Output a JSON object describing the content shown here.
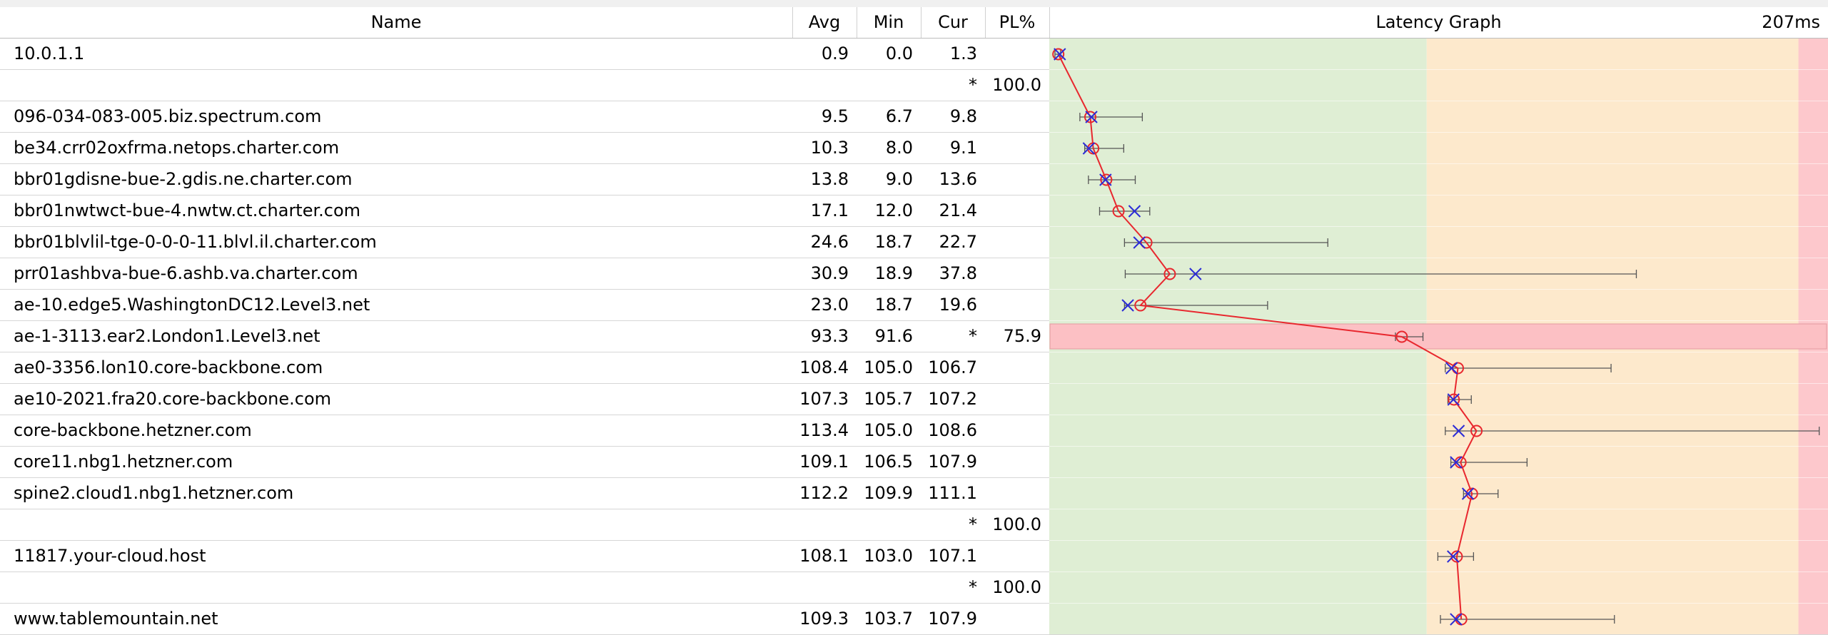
{
  "header": {
    "name": "Name",
    "avg": "Avg",
    "min": "Min",
    "cur": "Cur",
    "pl": "PL%",
    "graph": "Latency Graph",
    "scale": "207ms"
  },
  "graph": {
    "max_ms": 207,
    "green_until_ms": 100,
    "orange_until_ms": 200,
    "colors": {
      "green_zone": "#dfeed4",
      "orange_zone": "#fde9cc",
      "red_zone": "#fdc8cc",
      "loss_row": "#fcc0c4",
      "avg_line": "#e8272e",
      "cur_marker": "#2b2bd6",
      "whisker": "#555555"
    }
  },
  "hops": [
    {
      "name": "10.0.1.1",
      "avg": "0.9",
      "min": "0.0",
      "cur": "1.3",
      "pl": "",
      "max": 1.5
    },
    {
      "name": "",
      "avg": "",
      "min": "",
      "cur": "*",
      "pl": "100.0"
    },
    {
      "name": "096-034-083-005.biz.spectrum.com",
      "avg": "9.5",
      "min": "6.7",
      "cur": "9.8",
      "pl": "",
      "max": 23.5
    },
    {
      "name": "be34.crr02oxfrma.netops.charter.com",
      "avg": "10.3",
      "min": "8.0",
      "cur": "9.1",
      "pl": "",
      "max": 18.5
    },
    {
      "name": "bbr01gdisne-bue-2.gdis.ne.charter.com",
      "avg": "13.8",
      "min": "9.0",
      "cur": "13.6",
      "pl": "",
      "max": 21.6
    },
    {
      "name": "bbr01nwtwct-bue-4.nwtw.ct.charter.com",
      "avg": "17.1",
      "min": "12.0",
      "cur": "21.4",
      "pl": "",
      "max": 25.5
    },
    {
      "name": "bbr01blvlil-tge-0-0-0-11.blvl.il.charter.com",
      "avg": "24.6",
      "min": "18.7",
      "cur": "22.7",
      "pl": "",
      "max": 73.4
    },
    {
      "name": "prr01ashbva-bue-6.ashb.va.charter.com",
      "avg": "30.9",
      "min": "18.9",
      "cur": "37.8",
      "pl": "",
      "max": 156.4
    },
    {
      "name": "ae-10.edge5.WashingtonDC12.Level3.net",
      "avg": "23.0",
      "min": "18.7",
      "cur": "19.6",
      "pl": "",
      "max": 57.2
    },
    {
      "name": "ae-1-3113.ear2.London1.Level3.net",
      "avg": "93.3",
      "min": "91.6",
      "cur": "*",
      "pl": "75.9",
      "max": 99.0
    },
    {
      "name": "ae0-3356.lon10.core-backbone.com",
      "avg": "108.4",
      "min": "105.0",
      "cur": "106.7",
      "pl": "",
      "max": 149.6
    },
    {
      "name": "ae10-2021.fra20.core-backbone.com",
      "avg": "107.3",
      "min": "105.7",
      "cur": "107.2",
      "pl": "",
      "max": 112.0
    },
    {
      "name": "core-backbone.hetzner.com",
      "avg": "113.4",
      "min": "105.0",
      "cur": "108.6",
      "pl": "",
      "max": 205.6
    },
    {
      "name": "core11.nbg1.hetzner.com",
      "avg": "109.1",
      "min": "106.5",
      "cur": "107.9",
      "pl": "",
      "max": 127.0
    },
    {
      "name": "spine2.cloud1.nbg1.hetzner.com",
      "avg": "112.2",
      "min": "109.9",
      "cur": "111.1",
      "pl": "",
      "max": 119.2
    },
    {
      "name": "",
      "avg": "",
      "min": "",
      "cur": "*",
      "pl": "100.0"
    },
    {
      "name": "11817.your-cloud.host",
      "avg": "108.1",
      "min": "103.0",
      "cur": "107.1",
      "pl": "",
      "max": 112.6
    },
    {
      "name": "",
      "avg": "",
      "min": "",
      "cur": "*",
      "pl": "100.0"
    },
    {
      "name": "www.tablemountain.net",
      "avg": "109.3",
      "min": "103.7",
      "cur": "107.9",
      "pl": "",
      "max": 150.5
    }
  ]
}
